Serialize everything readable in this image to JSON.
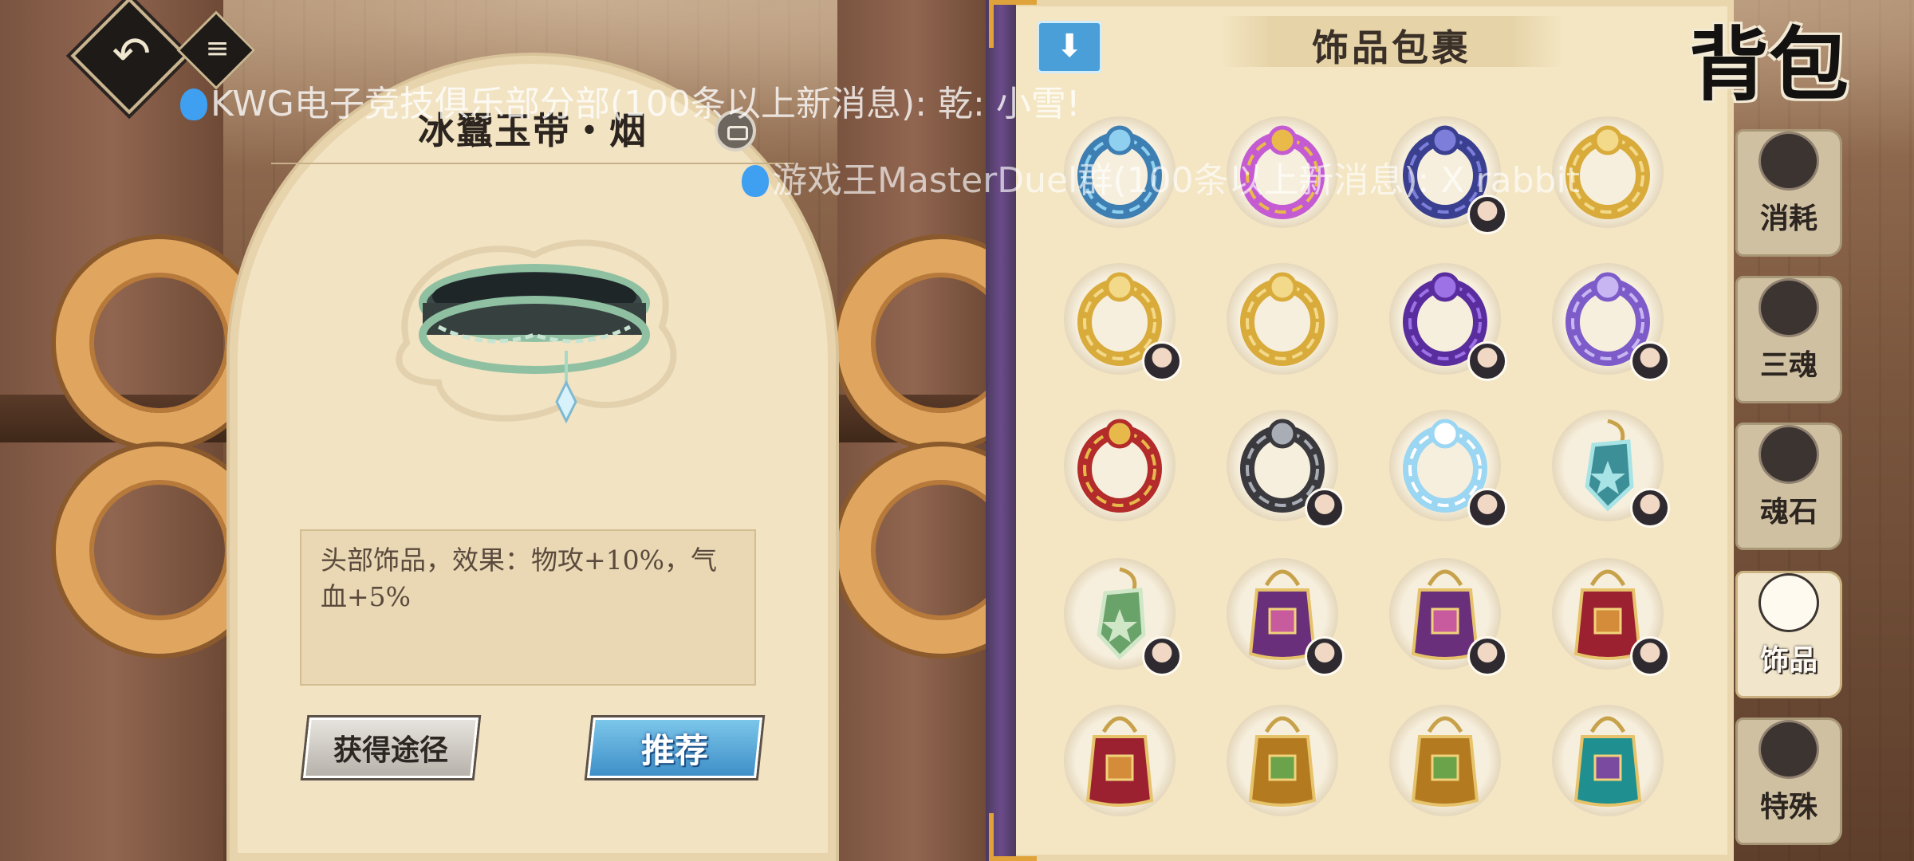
{
  "detail": {
    "title": "冰蠶玉带・烟",
    "description": "头部饰品，效果：物攻+10%，气血+5%",
    "buttons": {
      "source": "获得途径",
      "recommend": "推荐"
    }
  },
  "inventory": {
    "title": "饰品包裹",
    "bag_label": "背包",
    "slots": [
      {
        "item": "blue-stone-ring",
        "colors": [
          "#3e7fb3",
          "#8fd0f0"
        ],
        "avatar": false
      },
      {
        "item": "pink-gold-ring",
        "colors": [
          "#c45bd3",
          "#e9b94a"
        ],
        "avatar": false
      },
      {
        "item": "indigo-ring",
        "colors": [
          "#3a3f8f",
          "#7c7ed9"
        ],
        "avatar": true
      },
      {
        "item": "gold-ornate-ring",
        "colors": [
          "#d8ab3b",
          "#f3d98a"
        ],
        "avatar": false
      },
      {
        "item": "gold-ornate-ring",
        "colors": [
          "#d8ab3b",
          "#f3d98a"
        ],
        "avatar": true
      },
      {
        "item": "gold-ornate-ring",
        "colors": [
          "#d8ab3b",
          "#f3d98a"
        ],
        "avatar": false
      },
      {
        "item": "purple-serpent-ring",
        "colors": [
          "#5a2d9e",
          "#9d72e6"
        ],
        "avatar": true
      },
      {
        "item": "violet-ring",
        "colors": [
          "#7d5cc9",
          "#c8b6f2"
        ],
        "avatar": true
      },
      {
        "item": "dragon-red-ring",
        "colors": [
          "#b32b2b",
          "#e7b94a"
        ],
        "avatar": false
      },
      {
        "item": "silver-swan-ring",
        "colors": [
          "#3a3a3e",
          "#a9adb5"
        ],
        "avatar": true
      },
      {
        "item": "crystal-ring",
        "colors": [
          "#9bd6f2",
          "#ffffff"
        ],
        "avatar": true
      },
      {
        "item": "jade-pendant",
        "colors": [
          "#3d8f97",
          "#a8e3e6"
        ],
        "avatar": true
      },
      {
        "item": "green-jade-pendant",
        "colors": [
          "#6aa36a",
          "#cfe6c7"
        ],
        "avatar": true
      },
      {
        "item": "purple-pouch",
        "colors": [
          "#6a2f7a",
          "#c85a9e"
        ],
        "avatar": true
      },
      {
        "item": "purple-pouch",
        "colors": [
          "#6a2f7a",
          "#c85a9e"
        ],
        "avatar": true
      },
      {
        "item": "red-pouch",
        "colors": [
          "#9b2030",
          "#d48c3a"
        ],
        "avatar": true
      },
      {
        "item": "red-pouch",
        "colors": [
          "#9b2030",
          "#d48c3a"
        ],
        "avatar": false
      },
      {
        "item": "gold-pouch",
        "colors": [
          "#b37a20",
          "#6aa34a"
        ],
        "avatar": false
      },
      {
        "item": "gold-pouch",
        "colors": [
          "#b37a20",
          "#6aa34a"
        ],
        "avatar": false
      },
      {
        "item": "teal-pouch",
        "colors": [
          "#1f8f8f",
          "#7a4aa0"
        ],
        "avatar": false
      }
    ]
  },
  "tabs": [
    {
      "label": "消耗",
      "icon": "consumable-icon",
      "active": false
    },
    {
      "label": "三魂",
      "icon": "three-souls-icon",
      "active": false
    },
    {
      "label": "魂石",
      "icon": "soul-stone-icon",
      "active": false
    },
    {
      "label": "饰品",
      "icon": "accessory-icon",
      "active": true
    },
    {
      "label": "特殊",
      "icon": "special-icon",
      "active": false
    }
  ],
  "notifications": [
    {
      "text": "KWG电子竞技俱乐部分部(100条以上新消息): 乾: 小雪!"
    },
    {
      "text": "游戏王MasterDuel群(100条以上新消息): X rabbit"
    }
  ],
  "colors": {
    "accent_blue": "#4a9fd8",
    "panel": "#f4e6c3",
    "wood": "#7a563e"
  }
}
